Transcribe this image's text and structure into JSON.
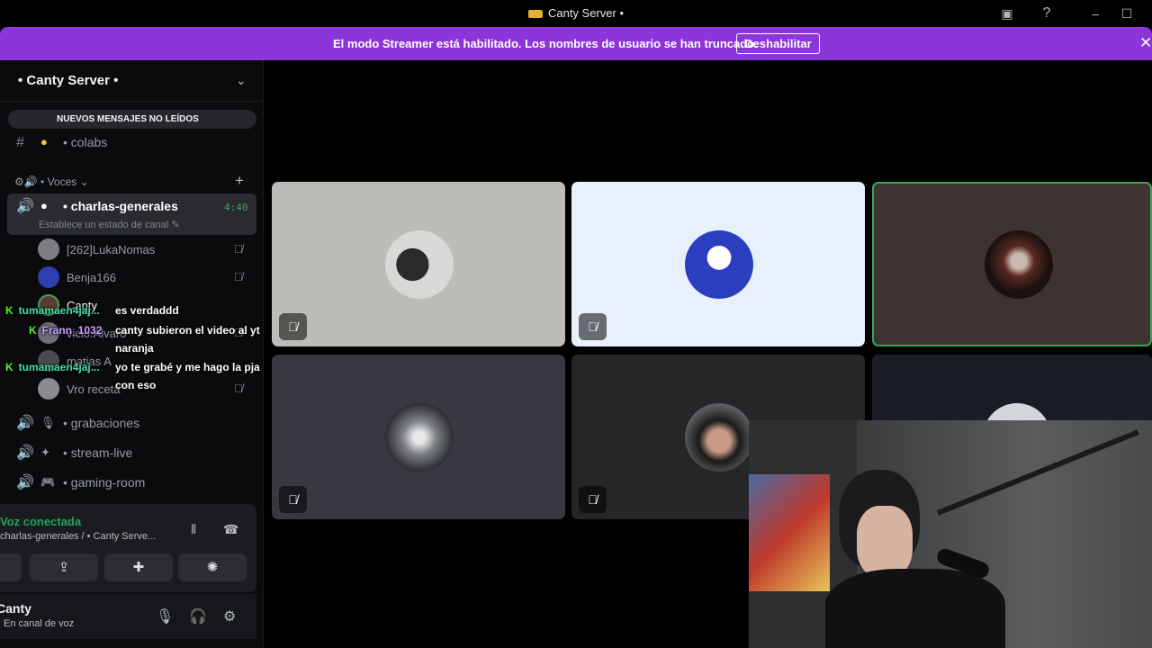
{
  "window": {
    "title": "Canty Server",
    "title_dot": "•"
  },
  "banner": {
    "message": "El modo Streamer está habilitado. Los nombres de usuario se han truncado.",
    "button": "Deshabilitar"
  },
  "server": {
    "name": "• Canty Server •"
  },
  "unread_pill": "NUEVOS MENSAJES NO LEÍDOS",
  "channels": {
    "colabs": "colabs",
    "category": "• Voces",
    "voice": [
      {
        "label": "charlas-generales",
        "time": "4:40",
        "status": "Establece un estado de canal"
      },
      {
        "label": "grabaciones"
      },
      {
        "label": "stream-live"
      },
      {
        "label": "gaming-room"
      }
    ]
  },
  "voice_users": [
    "[262]LukaNomas",
    "Benja166",
    "Canty",
    "vicio.Alvaro",
    "matias A",
    "Vro receta"
  ],
  "chat_overlay": [
    {
      "name": "tumamaen4jaj...",
      "message": "es verdaddd"
    },
    {
      "name": "Frann_1032",
      "message": "canty subieron el video al yt"
    },
    {
      "name": "",
      "message": "naranja"
    },
    {
      "name": "tumamaen4jaj...",
      "message": "yo te grabé y me hago la pja"
    },
    {
      "name": "",
      "message": "con eso"
    }
  ],
  "voice_connection": {
    "status": "Voz conectada",
    "location": "charlas-generales / • Canty Serve..."
  },
  "me": {
    "name": "Canty",
    "status": "En canal de voz"
  },
  "colors": {
    "banner": "#8c35d8",
    "speaking": "#3ba55d",
    "kick": "#53fc18"
  }
}
